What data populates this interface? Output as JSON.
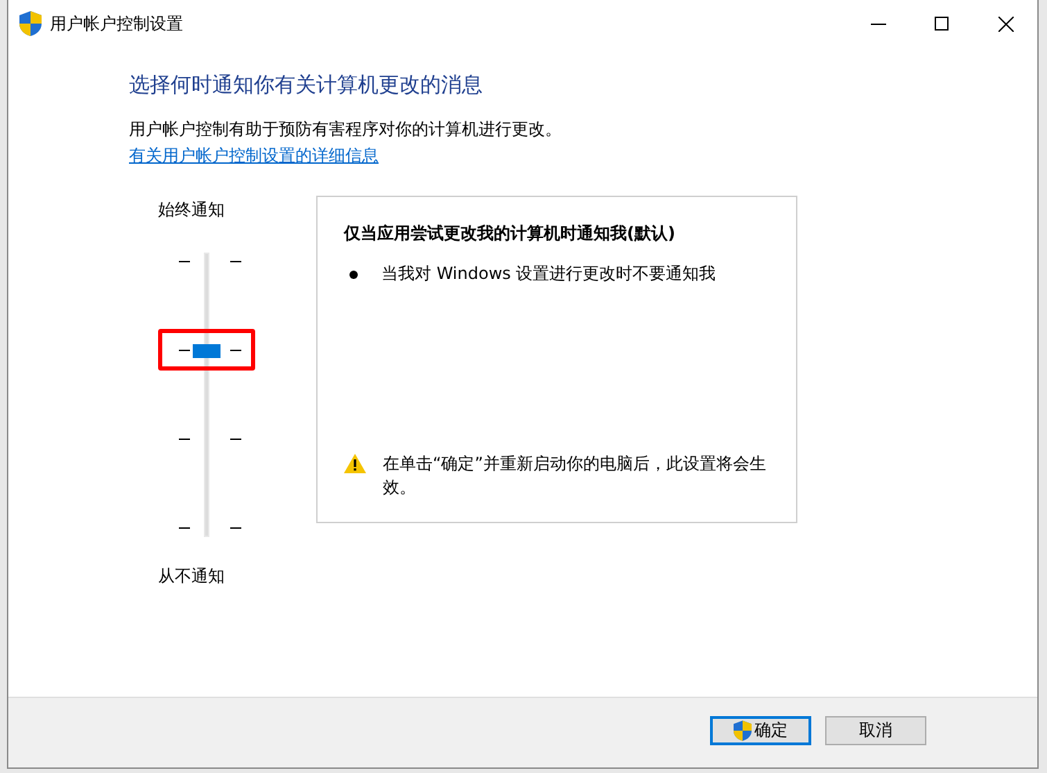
{
  "window": {
    "title": "用户帐户控制设置"
  },
  "heading": "选择何时通知你有关计算机更改的消息",
  "description": "用户帐户控制有助于预防有害程序对你的计算机进行更改。",
  "link": "有关用户帐户控制设置的详细信息",
  "slider": {
    "top_label": "始终通知",
    "bottom_label": "从不通知",
    "level": 0.667,
    "highlighted": true
  },
  "panel": {
    "title": "仅当应用尝试更改我的计算机时通知我(默认)",
    "bullets": [
      "当我对 Windows 设置进行更改时不要通知我"
    ],
    "warning": "在单击“确定”并重新启动你的电脑后，此设置将会生效。"
  },
  "buttons": [
    {
      "label": "确定",
      "kind": "primary"
    },
    {
      "label": "取消",
      "kind": "secondary"
    }
  ]
}
